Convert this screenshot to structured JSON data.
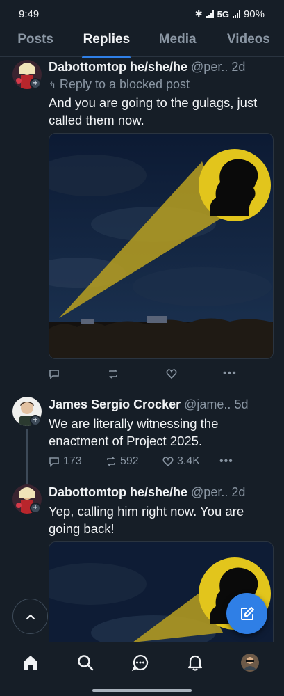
{
  "status": {
    "time": "9:49",
    "network": "5G",
    "battery": "90%"
  },
  "tabs": [
    {
      "label": "Posts",
      "active": false
    },
    {
      "label": "Replies",
      "active": true
    },
    {
      "label": "Media",
      "active": false
    },
    {
      "label": "Videos",
      "active": false
    }
  ],
  "posts": [
    {
      "author": "Dabottomtop he/she/he",
      "handle": "@per..",
      "time": "2d",
      "reply_note": "Reply to a blocked post",
      "text": "And you are going to the gulags, just called them now.",
      "has_media": true
    },
    {
      "author": "James Sergio Crocker",
      "handle": "@jame..",
      "time": "5d",
      "text": "We are literally witnessing the enactment of Project 2025.",
      "replies": "173",
      "reposts": "592",
      "likes": "3.4K"
    },
    {
      "author": "Dabottomtop he/she/he",
      "handle": "@per..",
      "time": "2d",
      "text": "Yep, calling him right now. You are going back!",
      "has_media": true
    }
  ],
  "colors": {
    "background": "#161e27",
    "accent": "#2f7fe6",
    "muted": "#8a96a3"
  }
}
